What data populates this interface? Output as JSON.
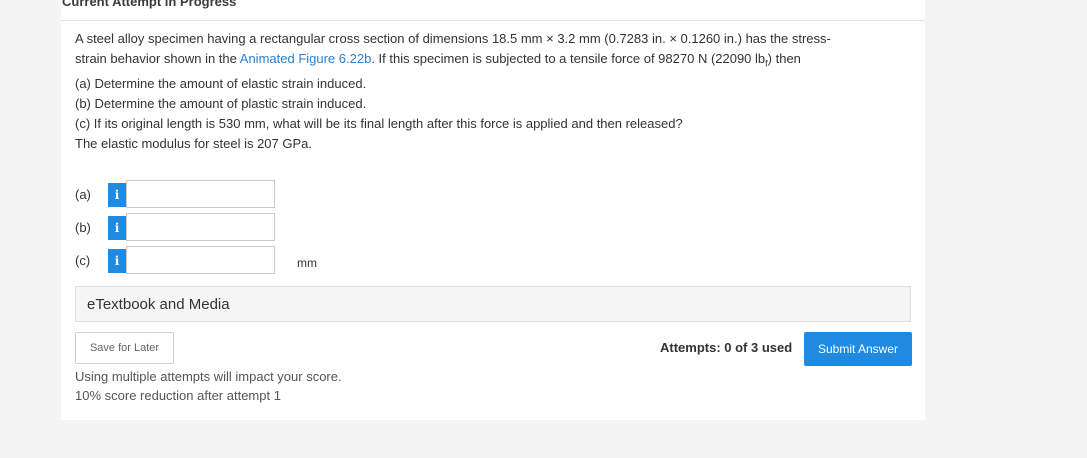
{
  "header": {
    "status": "Current Attempt in Progress"
  },
  "question": {
    "line1": "A steel alloy specimen having a rectangular cross section of dimensions 18.5 mm × 3.2 mm (0.7283 in. × 0.1260 in.) has the stress-",
    "line2_pre": "strain behavior shown in the ",
    "line2_link": "Animated Figure 6.22b",
    "line2_post_a": ". If this specimen is subjected to a tensile force of 98270 N (22090 lb",
    "line2_sub": "f",
    "line2_post_b": ") then",
    "part_a": "(a) Determine the amount of elastic strain induced.",
    "part_b": "(b) Determine the amount of plastic strain induced.",
    "part_c": "(c) If its original length is 530 mm, what will be its final length after this force is applied and then released?",
    "modulus": "The elastic modulus for steel is 207 GPa."
  },
  "answers": [
    {
      "label": "(a)",
      "info": "i",
      "value": "",
      "unit": ""
    },
    {
      "label": "(b)",
      "info": "i",
      "value": "",
      "unit": ""
    },
    {
      "label": "(c)",
      "info": "i",
      "value": "",
      "unit": "mm"
    }
  ],
  "media": {
    "label": "eTextbook and Media"
  },
  "footer": {
    "save_label": "Save for Later",
    "attempts": "Attempts: 0 of 3 used",
    "submit_label": "Submit Answer",
    "note1": "Using multiple attempts will impact your score.",
    "note2": "10% score reduction after attempt 1"
  },
  "colors": {
    "accent": "#1f8ae0",
    "link": "#2d7fd1"
  }
}
